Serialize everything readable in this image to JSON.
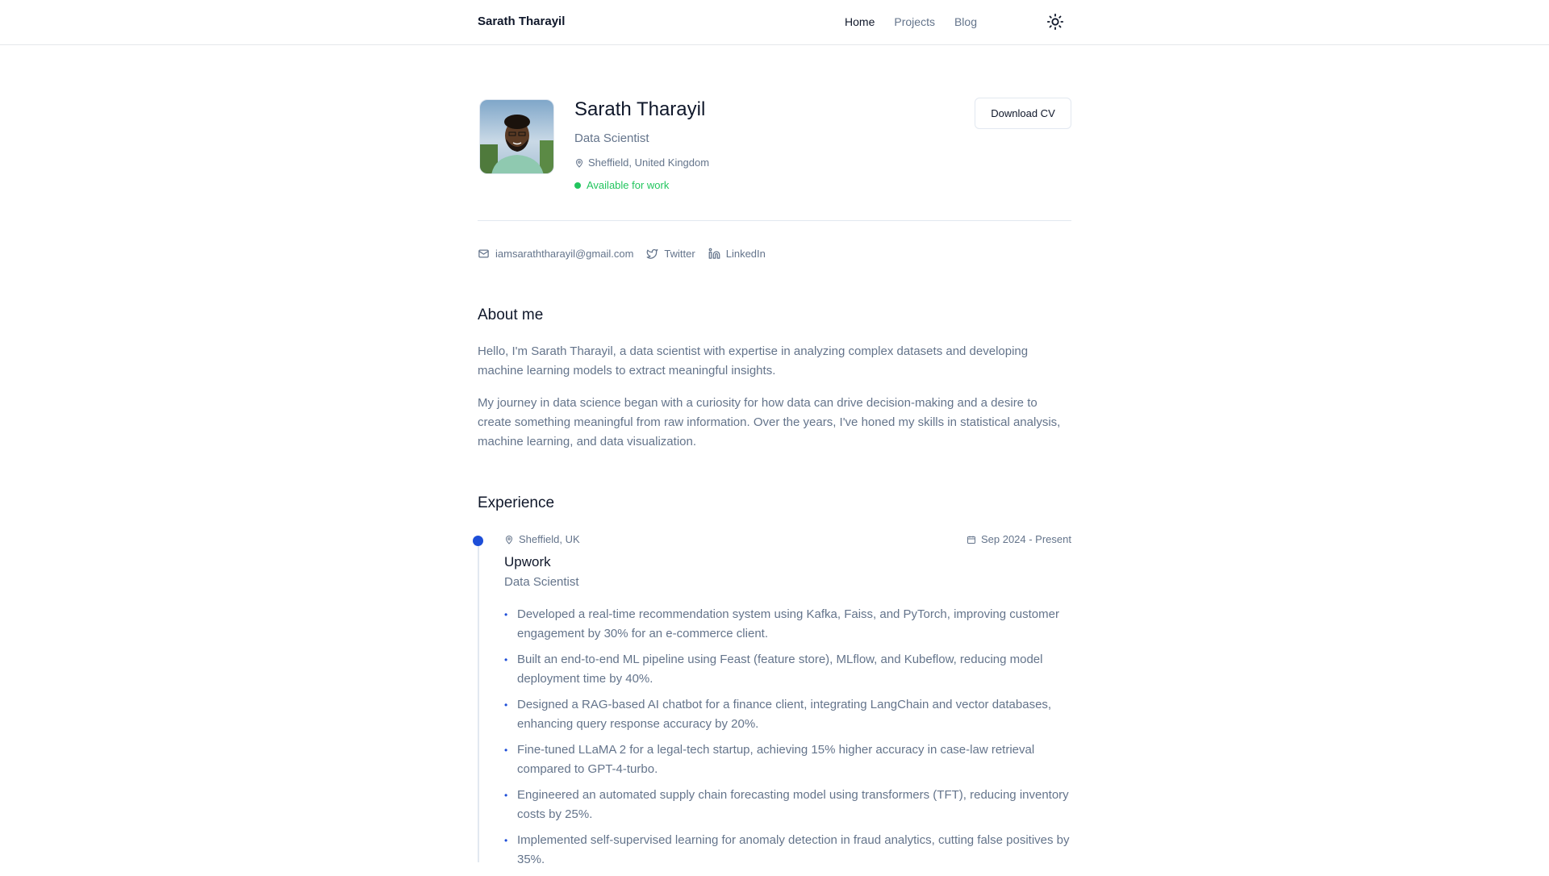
{
  "header": {
    "brand": "Sarath Tharayil",
    "nav": [
      {
        "label": "Home",
        "active": true
      },
      {
        "label": "Projects",
        "active": false
      },
      {
        "label": "Blog",
        "active": false
      }
    ],
    "theme_icon": "sun-icon"
  },
  "profile": {
    "name": "Sarath Tharayil",
    "role": "Data Scientist",
    "location": "Sheffield, United Kingdom",
    "status": "Available for work",
    "status_color": "#22c55e",
    "download_label": "Download CV"
  },
  "contacts": {
    "email": "iamsaraththarayil@gmail.com",
    "twitter": "Twitter",
    "linkedin": "LinkedIn"
  },
  "about": {
    "title": "About me",
    "paragraphs": [
      "Hello, I'm Sarath Tharayil, a data scientist with expertise in analyzing complex datasets and developing machine learning models to extract meaningful insights.",
      "My journey in data science began with a curiosity for how data can drive decision-making and a desire to create something meaningful from raw information. Over the years, I've honed my skills in statistical analysis, machine learning, and data visualization."
    ]
  },
  "experience": {
    "title": "Experience",
    "accent_color": "#1d4ed8",
    "jobs": [
      {
        "location": "Sheffield, UK",
        "dates": "Sep 2024 - Present",
        "company": "Upwork",
        "role": "Data Scientist",
        "bullets": [
          "Developed a real-time recommendation system using Kafka, Faiss, and PyTorch, improving customer engagement by 30% for an e-commerce client.",
          "Built an end-to-end ML pipeline using Feast (feature store), MLflow, and Kubeflow, reducing model deployment time by 40%.",
          "Designed a RAG-based AI chatbot for a finance client, integrating LangChain and vector databases, enhancing query response accuracy by 20%.",
          "Fine-tuned LLaMA 2 for a legal-tech startup, achieving 15% higher accuracy in case-law retrieval compared to GPT-4-turbo.",
          "Engineered an automated supply chain forecasting model using transformers (TFT), reducing inventory costs by 25%.",
          "Implemented self-supervised learning for anomaly detection in fraud analytics, cutting false positives by 35%."
        ]
      }
    ]
  }
}
